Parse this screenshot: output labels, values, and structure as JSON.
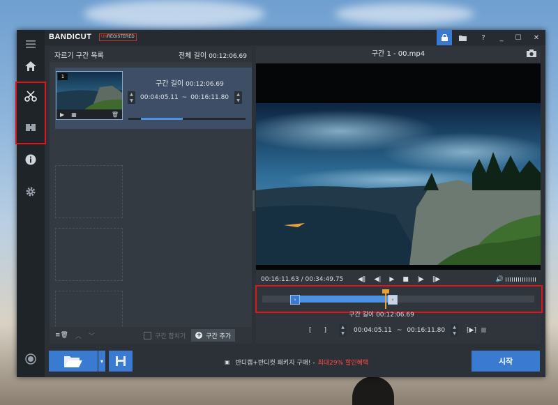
{
  "app": {
    "logo_main": "BANDI",
    "logo_cut": "CUT",
    "unregistered_prefix": "UN",
    "unregistered_rest": "REGISTERED",
    "window_buttons": [
      "?",
      "_",
      "☐",
      "✕"
    ]
  },
  "sidebar": {
    "items": [
      {
        "icon": "menu-icon"
      },
      {
        "icon": "home-icon"
      },
      {
        "icon": "cut-icon",
        "active": true
      },
      {
        "icon": "join-icon"
      },
      {
        "icon": "info-icon"
      },
      {
        "icon": "gear-icon"
      },
      {
        "icon": "record-icon"
      }
    ]
  },
  "segment_list": {
    "title": "자르기 구간 목록",
    "total_label": "전체 길이",
    "total_value": "00:12:06.69",
    "active": {
      "number": "1",
      "length_label": "구간 길이",
      "length_value": "00:12:06.69",
      "start": "00:04:05.11",
      "separator": "~",
      "end": "00:16:11.80"
    },
    "footer": {
      "merge_label": "구간 합치기",
      "add_label": "구간 추가"
    }
  },
  "player": {
    "title": "구간 1 - 00.mp4",
    "position": "00:16:11.63",
    "duration_sep": "/",
    "duration": "00:34:49.75",
    "cut_length_label": "구간 길이",
    "cut_length_value": "00:12:06.69",
    "cut_start": "00:04:05.11",
    "cut_sep": "~",
    "cut_end": "00:16:11.80",
    "bracket_in": "[",
    "bracket_out": "]",
    "play_segment": "[▶]"
  },
  "bottom": {
    "promo_text": "반디캠+반디컷 패키지 구매! -",
    "promo_highlight": "최대29% 할인혜택",
    "start_label": "시작"
  },
  "colors": {
    "accent": "#3a7ad1",
    "highlight_box": "#e0141b",
    "playhead": "#f0a030"
  }
}
